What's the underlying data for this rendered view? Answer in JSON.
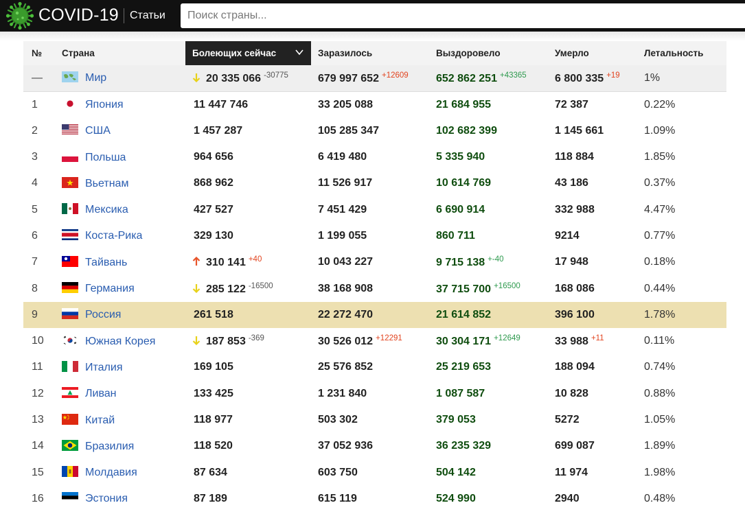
{
  "header": {
    "logo_text": "COVID-19",
    "nav_articles": "Статьи",
    "search_placeholder": "Поиск страны..."
  },
  "table": {
    "columns": {
      "rank": "№",
      "country": "Страна",
      "active": "Болеющих сейчас",
      "cases": "Заразилось",
      "recovered": "Выздоровело",
      "deaths": "Умерло",
      "lethality": "Летальность"
    },
    "sorted_column": "active",
    "world": {
      "rank": "—",
      "country": "Мир",
      "flag": "world",
      "active": "20 335 066",
      "active_delta": "-30775",
      "active_trend": "down",
      "cases": "679 997 652",
      "cases_delta": "+12609",
      "recovered": "652 862 251",
      "recovered_delta": "+43365",
      "deaths": "6 800 335",
      "deaths_delta": "+19",
      "lethality": "1%"
    },
    "rows": [
      {
        "rank": "1",
        "country": "Япония",
        "flag": "jp",
        "active": "11 447 746",
        "cases": "33 205 088",
        "recovered": "21 684 955",
        "deaths": "72 387",
        "lethality": "0.22%"
      },
      {
        "rank": "2",
        "country": "США",
        "flag": "us",
        "active": "1 457 287",
        "cases": "105 285 347",
        "recovered": "102 682 399",
        "deaths": "1 145 661",
        "lethality": "1.09%"
      },
      {
        "rank": "3",
        "country": "Польша",
        "flag": "pl",
        "active": "964 656",
        "cases": "6 419 480",
        "recovered": "5 335 940",
        "deaths": "118 884",
        "lethality": "1.85%"
      },
      {
        "rank": "4",
        "country": "Вьетнам",
        "flag": "vn",
        "active": "868 962",
        "cases": "11 526 917",
        "recovered": "10 614 769",
        "deaths": "43 186",
        "lethality": "0.37%"
      },
      {
        "rank": "5",
        "country": "Мексика",
        "flag": "mx",
        "active": "427 527",
        "cases": "7 451 429",
        "recovered": "6 690 914",
        "deaths": "332 988",
        "lethality": "4.47%"
      },
      {
        "rank": "6",
        "country": "Коста-Рика",
        "flag": "cr",
        "active": "329 130",
        "cases": "1 199 055",
        "recovered": "860 711",
        "deaths": "9214",
        "lethality": "0.77%"
      },
      {
        "rank": "7",
        "country": "Тайвань",
        "flag": "tw",
        "active": "310 141",
        "active_delta": "+40",
        "active_trend": "up",
        "cases": "10 043 227",
        "recovered": "9 715 138",
        "recovered_delta": "+-40",
        "deaths": "17 948",
        "lethality": "0.18%"
      },
      {
        "rank": "8",
        "country": "Германия",
        "flag": "de",
        "active": "285 122",
        "active_delta": "-16500",
        "active_trend": "down",
        "cases": "38 168 908",
        "recovered": "37 715 700",
        "recovered_delta": "+16500",
        "deaths": "168 086",
        "lethality": "0.44%"
      },
      {
        "rank": "9",
        "country": "Россия",
        "flag": "ru",
        "active": "261 518",
        "cases": "22 272 470",
        "recovered": "21 614 852",
        "deaths": "396 100",
        "lethality": "1.78%",
        "highlight": true
      },
      {
        "rank": "10",
        "country": "Южная Корея",
        "flag": "kr",
        "active": "187 853",
        "active_delta": "-369",
        "active_trend": "down",
        "cases": "30 526 012",
        "cases_delta": "+12291",
        "recovered": "30 304 171",
        "recovered_delta": "+12649",
        "deaths": "33 988",
        "deaths_delta": "+11",
        "lethality": "0.11%"
      },
      {
        "rank": "11",
        "country": "Италия",
        "flag": "it",
        "active": "169 105",
        "cases": "25 576 852",
        "recovered": "25 219 653",
        "deaths": "188 094",
        "lethality": "0.74%"
      },
      {
        "rank": "12",
        "country": "Ливан",
        "flag": "lb",
        "active": "133 425",
        "cases": "1 231 840",
        "recovered": "1 087 587",
        "deaths": "10 828",
        "lethality": "0.88%"
      },
      {
        "rank": "13",
        "country": "Китай",
        "flag": "cn",
        "active": "118 977",
        "cases": "503 302",
        "recovered": "379 053",
        "deaths": "5272",
        "lethality": "1.05%"
      },
      {
        "rank": "14",
        "country": "Бразилия",
        "flag": "br",
        "active": "118 520",
        "cases": "37 052 936",
        "recovered": "36 235 329",
        "deaths": "699 087",
        "lethality": "1.89%"
      },
      {
        "rank": "15",
        "country": "Молдавия",
        "flag": "md",
        "active": "87 634",
        "cases": "603 750",
        "recovered": "504 142",
        "deaths": "11 974",
        "lethality": "1.98%"
      },
      {
        "rank": "16",
        "country": "Эстония",
        "flag": "ee",
        "active": "87 189",
        "cases": "615 119",
        "recovered": "524 990",
        "deaths": "2940",
        "lethality": "0.48%"
      }
    ]
  },
  "colors": {
    "topbar": "#111111",
    "link": "#2a5db0",
    "recovered": "#0f4d0f",
    "delta_up": "#e2431e",
    "delta_recovered": "#2e9a4e",
    "highlight_row": "#ede0b1",
    "arrow_down": "#e8d21a",
    "arrow_up": "#e8542a"
  },
  "icons": {
    "logo": "virus-icon",
    "sort": "chevron-down-icon",
    "trend_down": "arrow-down-icon",
    "trend_up": "arrow-up-icon"
  }
}
